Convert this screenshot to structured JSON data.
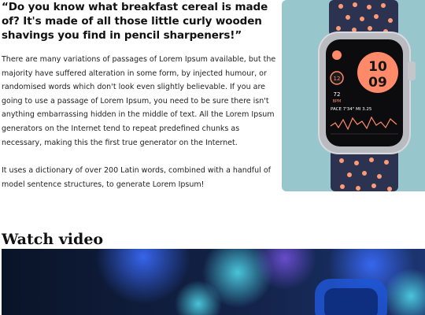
{
  "article": {
    "quote": "“Do you know what breakfast cereal is made of? It's made of all those little curly wooden shavings you find in pencil sharpeners!”",
    "paragraph_1": "There are many variations of passages of Lorem Ipsum available, but the majority have suffered alteration in some form, by injected humour, or randomised words which don't look even slightly believable. If you are going to use a passage of Lorem Ipsum, you need to be sure there isn't anything embarrassing hidden in the middle of text. All the Lorem Ipsum generators on the Internet tend to repeat predefined chunks as necessary, making this the first true generator on the Internet.",
    "paragraph_2": "It uses a dictionary of over 200 Latin words, combined with a handful of model sentence structures, to generate Lorem Ipsum!"
  },
  "watch_image": {
    "background_color": "#97c6cc",
    "watch_face": {
      "hour": "10",
      "minute": "09",
      "complication_top": "12",
      "complication_bottom_value": "72",
      "complication_bottom_label": "BPM",
      "pace_text": "PACE 7'34\" MI 3.25"
    }
  },
  "video_section": {
    "heading": "Watch video"
  }
}
